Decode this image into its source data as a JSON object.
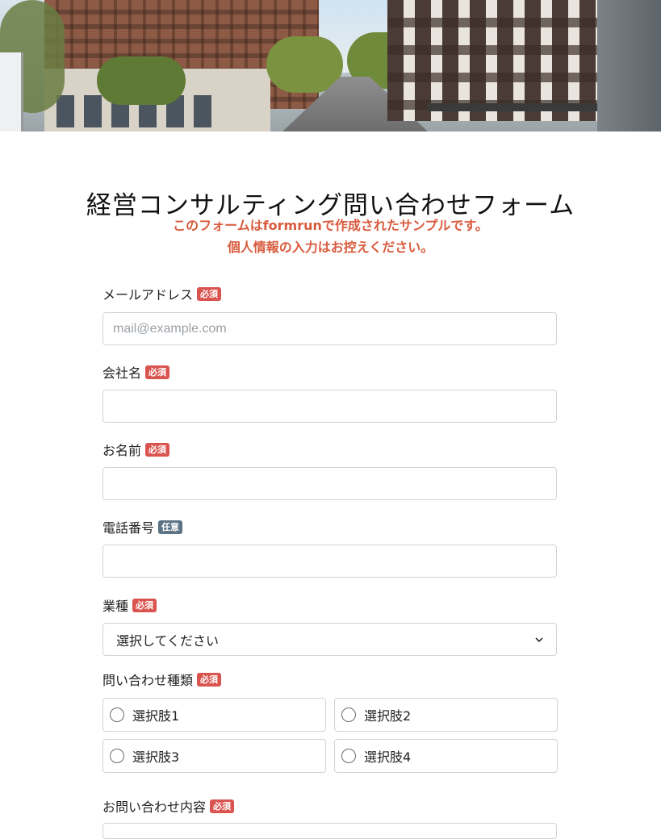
{
  "form": {
    "title": "経営コンサルティング問い合わせフォーム",
    "notice_line1": "このフォームはformrunで作成されたサンプルです。",
    "notice_line2": "個人情報の入力はお控えください。"
  },
  "badges": {
    "required": "必須",
    "optional": "任意"
  },
  "fields": {
    "email": {
      "label": "メールアドレス",
      "placeholder": "mail@example.com",
      "value": ""
    },
    "company": {
      "label": "会社名",
      "value": ""
    },
    "name": {
      "label": "お名前",
      "value": ""
    },
    "phone": {
      "label": "電話番号",
      "value": ""
    },
    "industry": {
      "label": "業種",
      "selected": "選択してください"
    },
    "inquiry_type": {
      "label": "問い合わせ種類",
      "options": [
        "選択肢1",
        "選択肢2",
        "選択肢3",
        "選択肢4"
      ]
    },
    "inquiry_content": {
      "label": "お問い合わせ内容"
    }
  },
  "colors": {
    "notice": "#d95b3e",
    "required_badge": "#d9534f",
    "optional_badge": "#5b7384",
    "input_border": "#cfd4d8"
  },
  "icons": {
    "select_arrow": "chevron-down-icon"
  }
}
